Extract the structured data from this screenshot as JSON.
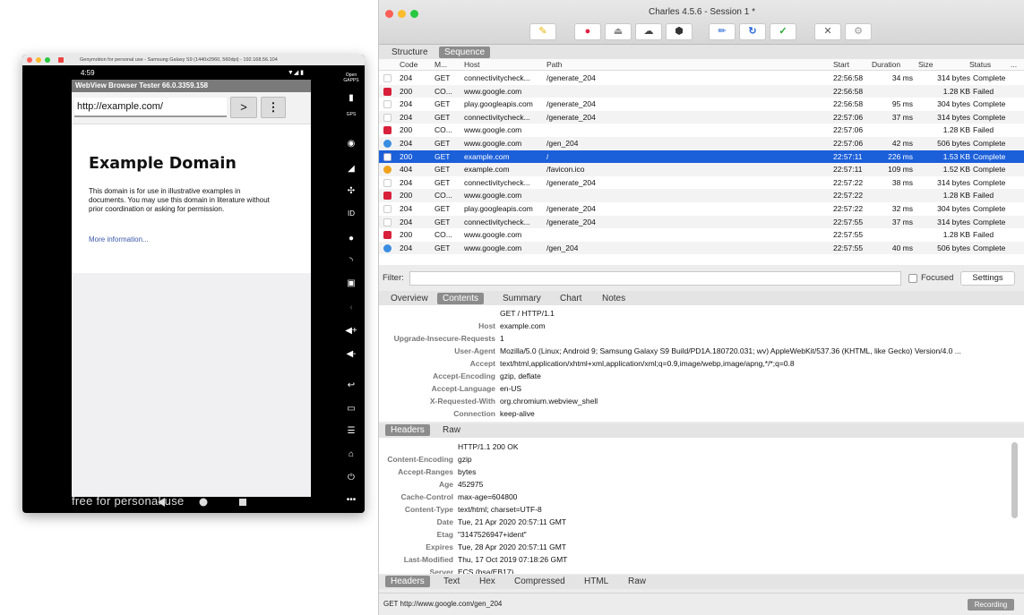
{
  "genymotion": {
    "window_title": "Genymotion for personal use - Samsung Galaxy S9 (1440x2960, 560dpi) - 192.168.56.104",
    "status_time": "4:59",
    "app_title": "WebView Browser Tester 66.0.3359.158",
    "url_value": "http://example.com/",
    "go_button": ">",
    "menu_button": "⋮",
    "page_heading": "Example Domain",
    "page_paragraph": "This domain is for use in illustrative examples in documents. You may use this domain in literature without prior coordination or asking for permission.",
    "page_link": "More information...",
    "watermark": "free for personal use",
    "sidebar_labels": [
      "Open GAPPS",
      "GPS"
    ]
  },
  "charles": {
    "window_title": "Charles 4.5.6 - Session 1 *",
    "view_tabs": [
      "Structure",
      "Sequence"
    ],
    "table": {
      "headers": [
        "Code",
        "M...",
        "Host",
        "Path",
        "Start",
        "Duration",
        "Size",
        "Status",
        "..."
      ],
      "rows": [
        {
          "icon": "doc",
          "code": "204",
          "method": "GET",
          "host": "connectivitycheck...",
          "path": "/generate_204",
          "start": "22:56:58",
          "duration": "34 ms",
          "size": "314 bytes",
          "status": "Complete"
        },
        {
          "icon": "error",
          "code": "200",
          "method": "CO...",
          "host": "www.google.com",
          "path": "",
          "start": "22:56:58",
          "duration": "",
          "size": "1.28 KB",
          "status": "Failed"
        },
        {
          "icon": "doc",
          "code": "204",
          "method": "GET",
          "host": "play.googleapis.com",
          "path": "/generate_204",
          "start": "22:56:58",
          "duration": "95 ms",
          "size": "304 bytes",
          "status": "Complete"
        },
        {
          "icon": "doc",
          "code": "204",
          "method": "GET",
          "host": "connectivitycheck...",
          "path": "/generate_204",
          "start": "22:57:06",
          "duration": "37 ms",
          "size": "314 bytes",
          "status": "Complete"
        },
        {
          "icon": "error",
          "code": "200",
          "method": "CO...",
          "host": "www.google.com",
          "path": "",
          "start": "22:57:06",
          "duration": "",
          "size": "1.28 KB",
          "status": "Failed"
        },
        {
          "icon": "globe",
          "code": "204",
          "method": "GET",
          "host": "www.google.com",
          "path": "/gen_204",
          "start": "22:57:06",
          "duration": "42 ms",
          "size": "506 bytes",
          "status": "Complete"
        },
        {
          "icon": "page",
          "code": "200",
          "method": "GET",
          "host": "example.com",
          "path": "/",
          "start": "22:57:11",
          "duration": "226 ms",
          "size": "1.53 KB",
          "status": "Complete",
          "selected": true
        },
        {
          "icon": "warning",
          "code": "404",
          "method": "GET",
          "host": "example.com",
          "path": "/favicon.ico",
          "start": "22:57:11",
          "duration": "109 ms",
          "size": "1.52 KB",
          "status": "Complete"
        },
        {
          "icon": "doc",
          "code": "204",
          "method": "GET",
          "host": "connectivitycheck...",
          "path": "/generate_204",
          "start": "22:57:22",
          "duration": "38 ms",
          "size": "314 bytes",
          "status": "Complete"
        },
        {
          "icon": "error",
          "code": "200",
          "method": "CO...",
          "host": "www.google.com",
          "path": "",
          "start": "22:57:22",
          "duration": "",
          "size": "1.28 KB",
          "status": "Failed"
        },
        {
          "icon": "doc",
          "code": "204",
          "method": "GET",
          "host": "play.googleapis.com",
          "path": "/generate_204",
          "start": "22:57:22",
          "duration": "32 ms",
          "size": "304 bytes",
          "status": "Complete"
        },
        {
          "icon": "doc",
          "code": "204",
          "method": "GET",
          "host": "connectivitycheck...",
          "path": "/generate_204",
          "start": "22:57:55",
          "duration": "37 ms",
          "size": "314 bytes",
          "status": "Complete"
        },
        {
          "icon": "error",
          "code": "200",
          "method": "CO...",
          "host": "www.google.com",
          "path": "",
          "start": "22:57:55",
          "duration": "",
          "size": "1.28 KB",
          "status": "Failed"
        },
        {
          "icon": "globe",
          "code": "204",
          "method": "GET",
          "host": "www.google.com",
          "path": "/gen_204",
          "start": "22:57:55",
          "duration": "40 ms",
          "size": "506 bytes",
          "status": "Complete"
        }
      ]
    },
    "filter": {
      "label": "Filter:",
      "value": "",
      "focused_label": "Focused",
      "settings_label": "Settings"
    },
    "detail_tabs": [
      "Overview",
      "Contents",
      "Summary",
      "Chart",
      "Notes"
    ],
    "request": {
      "first_line": "GET / HTTP/1.1",
      "headers": [
        {
          "key": "Host",
          "value": "example.com"
        },
        {
          "key": "Upgrade-Insecure-Requests",
          "value": "1"
        },
        {
          "key": "User-Agent",
          "value": "Mozilla/5.0 (Linux; Android 9; Samsung Galaxy S9 Build/PD1A.180720.031; wv) AppleWebKit/537.36 (KHTML, like Gecko) Version/4.0 ..."
        },
        {
          "key": "Accept",
          "value": "text/html,application/xhtml+xml,application/xml;q=0.9,image/webp,image/apng,*/*;q=0.8"
        },
        {
          "key": "Accept-Encoding",
          "value": "gzip, deflate"
        },
        {
          "key": "Accept-Language",
          "value": "en-US"
        },
        {
          "key": "X-Requested-With",
          "value": "org.chromium.webview_shell"
        },
        {
          "key": "Connection",
          "value": "keep-alive"
        }
      ]
    },
    "request_tabs": [
      "Headers",
      "Raw"
    ],
    "response": {
      "first_line": "HTTP/1.1 200 OK",
      "headers": [
        {
          "key": "Content-Encoding",
          "value": "gzip"
        },
        {
          "key": "Accept-Ranges",
          "value": "bytes"
        },
        {
          "key": "Age",
          "value": "452975"
        },
        {
          "key": "Cache-Control",
          "value": "max-age=604800"
        },
        {
          "key": "Content-Type",
          "value": "text/html; charset=UTF-8"
        },
        {
          "key": "Date",
          "value": "Tue, 21 Apr 2020 20:57:11 GMT"
        },
        {
          "key": "Etag",
          "value": "\"3147526947+ident\""
        },
        {
          "key": "Expires",
          "value": "Tue, 28 Apr 2020 20:57:11 GMT"
        },
        {
          "key": "Last-Modified",
          "value": "Thu, 17 Oct 2019 07:18:26 GMT"
        },
        {
          "key": "Server",
          "value": "ECS (bsa/EB17)"
        }
      ]
    },
    "response_tabs": [
      "Headers",
      "Text",
      "Hex",
      "Compressed",
      "HTML",
      "Raw"
    ],
    "status_text": "GET http://www.google.com/gen_204",
    "recording_label": "Recording",
    "colors": {
      "selection": "#1b5fd9",
      "error": "#d8203a",
      "warning": "#f0a21c",
      "globe": "#3a8de0"
    }
  }
}
